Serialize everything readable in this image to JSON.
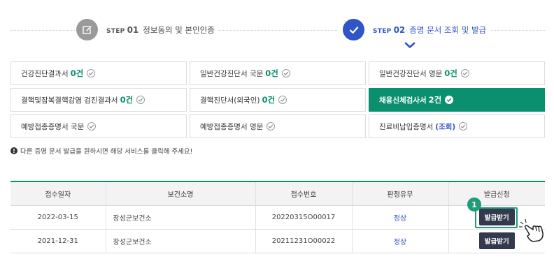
{
  "steps": [
    {
      "prefix": "STEP",
      "num": "01",
      "title": "정보동의 및 본인인증",
      "state": "done",
      "icon": "pencil-edit-icon"
    },
    {
      "prefix": "STEP",
      "num": "02",
      "title": "증명 문서 조회 및 발급",
      "state": "current",
      "icon": "checkmark-icon"
    }
  ],
  "documents": [
    {
      "label": "건강진단결과서",
      "count": "0건"
    },
    {
      "label": "일반건강진단서 국문",
      "count": "0건"
    },
    {
      "label": "일반건강진단서 영문",
      "count": "0건"
    },
    {
      "label": "결핵및잠복결핵감염 검진결과서",
      "count": "0건"
    },
    {
      "label": "결핵진단서(외국인)",
      "count": "0건"
    },
    {
      "label": "채용신체검사서",
      "count": "2건"
    },
    {
      "label": "예방접종증명서 국문",
      "count": ""
    },
    {
      "label": "예방접종증명서 영문",
      "count": ""
    },
    {
      "label": "진료비납입증명서",
      "count": "(조회)"
    }
  ],
  "notice": "다른 증명 문서 발급을 원하시면 해당 서비스를 클릭해 주세요!",
  "table": {
    "headers": [
      "접수일자",
      "보건소명",
      "접수번호",
      "판정유무",
      "발급신청"
    ],
    "rows": [
      {
        "date": "2022-03-15",
        "center": "장성군보건소",
        "number": "20220315O00017",
        "result": "정상",
        "action": "발급받기"
      },
      {
        "date": "2021-12-31",
        "center": "장성군보건소",
        "number": "20211231O00022",
        "result": "정상",
        "action": "발급받기"
      }
    ]
  },
  "callout_badge": "1",
  "colors": {
    "accent_green": "#0a8f6f",
    "step_blue": "#2f55c7",
    "button_dark": "#333a4d"
  }
}
